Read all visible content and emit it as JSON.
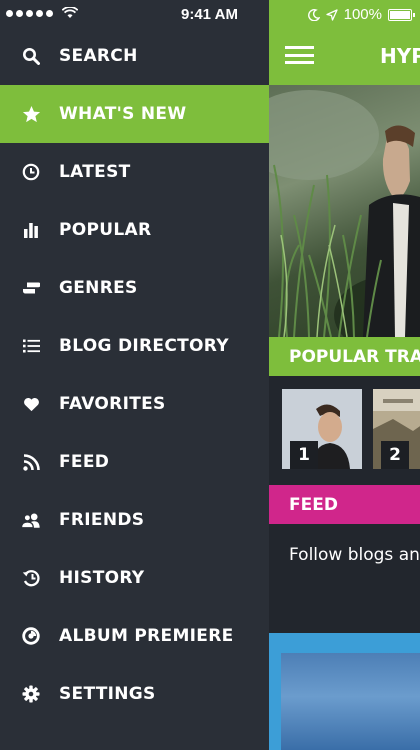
{
  "status_bar": {
    "time": "9:41 AM",
    "battery": "100%"
  },
  "sidebar": {
    "items": [
      {
        "label": "SEARCH",
        "icon": "search-icon"
      },
      {
        "label": "WHAT'S NEW",
        "icon": "star-icon",
        "active": true
      },
      {
        "label": "LATEST",
        "icon": "clock-icon"
      },
      {
        "label": "POPULAR",
        "icon": "bar-chart-icon"
      },
      {
        "label": "GENRES",
        "icon": "genres-icon"
      },
      {
        "label": "BLOG DIRECTORY",
        "icon": "list-icon"
      },
      {
        "label": "FAVORITES",
        "icon": "heart-icon"
      },
      {
        "label": "FEED",
        "icon": "rss-icon"
      },
      {
        "label": "FRIENDS",
        "icon": "friends-icon"
      },
      {
        "label": "HISTORY",
        "icon": "history-icon"
      },
      {
        "label": "ALBUM PREMIERE",
        "icon": "album-icon"
      },
      {
        "label": "SETTINGS",
        "icon": "gear-icon"
      }
    ]
  },
  "main": {
    "brand": "HYPE",
    "popular_tracks_label": "POPULAR TRACKS",
    "tracks": [
      {
        "rank": "1"
      },
      {
        "rank": "2"
      }
    ],
    "feed_label": "FEED",
    "feed_text": "Follow blogs and"
  },
  "colors": {
    "sidebar_bg": "#2a2f37",
    "accent_green": "#7ebe3c",
    "feed_pink": "#d0268b",
    "blue_block": "#3c9ed7"
  }
}
